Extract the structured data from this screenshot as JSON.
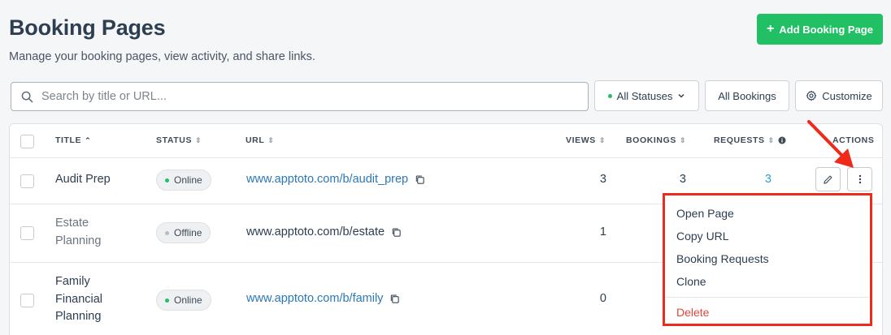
{
  "header": {
    "title": "Booking Pages",
    "subtitle": "Manage your booking pages, view activity, and share links.",
    "add_button_label": "Add Booking Page"
  },
  "toolbar": {
    "search_placeholder": "Search by title or URL...",
    "status_filter_label": "All Statuses",
    "all_bookings_label": "All Bookings",
    "customize_label": "Customize"
  },
  "table": {
    "headers": {
      "title": "TITLE",
      "status": "STATUS",
      "url": "URL",
      "views": "VIEWS",
      "bookings": "BOOKINGS",
      "requests": "REQUESTS",
      "actions": "ACTIONS"
    },
    "rows": [
      {
        "title": "Audit Prep",
        "status": "Online",
        "url": "www.apptoto.com/b/audit_prep",
        "views": "3",
        "bookings": "3",
        "requests": "3"
      },
      {
        "title": "Estate Planning",
        "status": "Offline",
        "url": "www.apptoto.com/b/estate",
        "views": "1"
      },
      {
        "title": "Family Financial Planning",
        "status": "Online",
        "url": "www.apptoto.com/b/family",
        "views": "0"
      }
    ]
  },
  "actions_menu": {
    "items": [
      "Open Page",
      "Copy URL",
      "Booking Requests",
      "Clone"
    ],
    "delete_label": "Delete"
  },
  "colors": {
    "primary_green": "#21c064",
    "link_blue": "#2a78b8",
    "highlight_red": "#ee2a1b",
    "offline_gray": "#b7bdc3"
  }
}
